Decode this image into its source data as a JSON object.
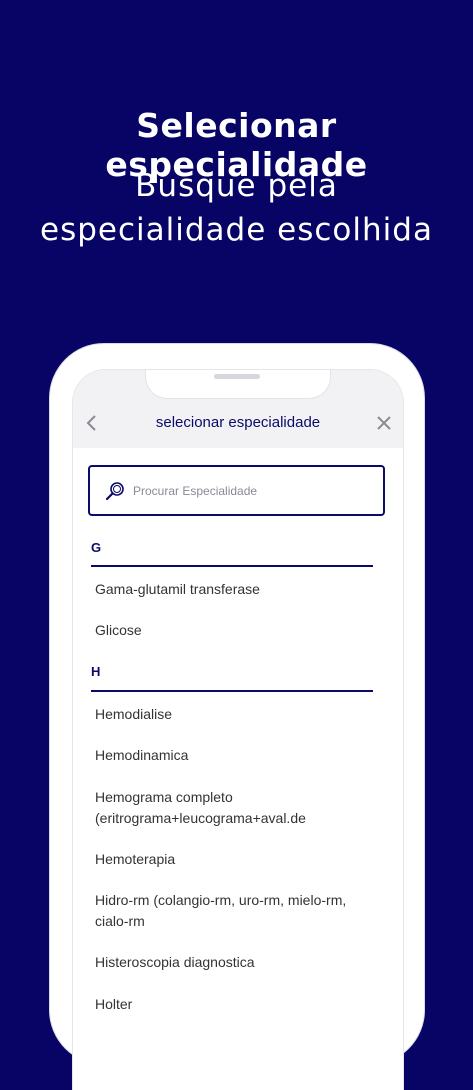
{
  "promo": {
    "title": "Selecionar especialidade",
    "subtitle": "Busque pela especialidade escolhida"
  },
  "header": {
    "back_icon": "chevron-left-icon",
    "title": "selecionar especialidade",
    "close_icon": "close-icon"
  },
  "search": {
    "icon": "search-icon",
    "placeholder": "Procurar Especialidade"
  },
  "sections": [
    {
      "letter": "G",
      "items": [
        "Gama-glutamil transferase",
        "Glicose"
      ]
    },
    {
      "letter": "H",
      "items": [
        "Hemodialise",
        "Hemodinamica",
        "Hemograma completo (eritrograma+leucograma+aval.de",
        "Hemoterapia",
        "Hidro-rm (colangio-rm, uro-rm, mielo-rm, cialo-rm",
        "Histeroscopia diagnostica",
        "Holter"
      ]
    }
  ],
  "colors": {
    "background": "#070466",
    "accent": "#0a0a6a",
    "header_bg": "#f2f2f4"
  }
}
